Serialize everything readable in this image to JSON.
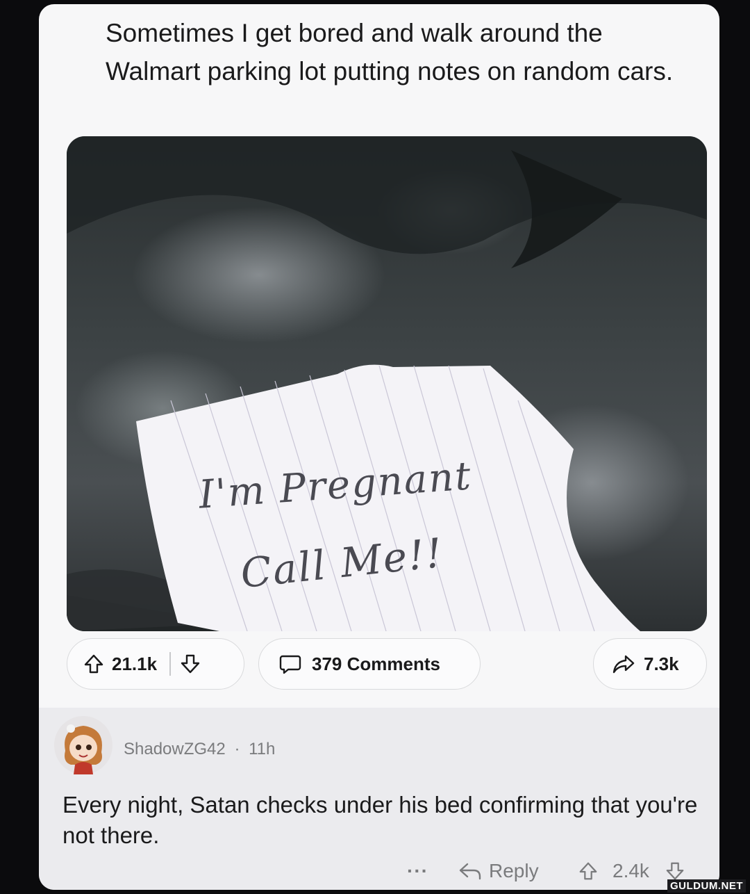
{
  "post": {
    "title": "Sometimes I get bored and walk around the Walmart parking lot putting notes on random cars.",
    "image_note_line1": "I'm Pregnant",
    "image_note_line2": "Call Me!!",
    "upvotes": "21.1k",
    "comments_label": "379 Comments",
    "shares": "7.3k"
  },
  "comment": {
    "username": "ShadowZG42",
    "separator": "·",
    "time": "11h",
    "text": "Every night, Satan checks under his bed confirming that you're not there.",
    "more_label": "···",
    "reply_label": "Reply",
    "upvotes": "2.4k"
  },
  "watermark": "GULDUM.NET",
  "colors": {
    "card_bg": "#f7f7f8",
    "comment_bg": "#ebebee",
    "text": "#1a1a1b",
    "muted": "#7a7b7d"
  },
  "icons": [
    "upvote-icon",
    "downvote-icon",
    "comment-icon",
    "share-icon",
    "reply-icon",
    "more-icon"
  ]
}
